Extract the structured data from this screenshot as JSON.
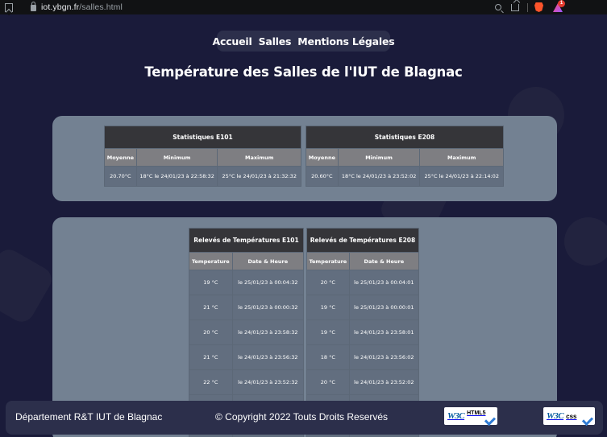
{
  "browser": {
    "url_domain": "iot.ybgn.fr",
    "url_path": "/salles.html",
    "rewards_count": "1"
  },
  "nav": {
    "items": [
      "Accueil",
      "Salles",
      "Mentions Légales"
    ]
  },
  "page_title": "Température des Salles de l'IUT de Blagnac",
  "stats": [
    {
      "title": "Statistiques E101",
      "headers": [
        "Moyenne",
        "Minimum",
        "Maximum"
      ],
      "row": [
        "20.70°C",
        "18°C le 24/01/23 à 22:58:32",
        "25°C le 24/01/23 à 21:32:32"
      ]
    },
    {
      "title": "Statistiques E208",
      "headers": [
        "Moyenne",
        "Minimum",
        "Maximum"
      ],
      "row": [
        "20.60°C",
        "18°C le 24/01/23 à 23:52:02",
        "25°C le 24/01/23 à 22:14:02"
      ]
    }
  ],
  "readings": [
    {
      "title": "Relevés de Températures E101",
      "headers": [
        "Temperature",
        "Date & Heure"
      ],
      "rows": [
        [
          "19 °C",
          "le 25/01/23 à 00:04:32"
        ],
        [
          "21 °C",
          "le 25/01/23 à 00:00:32"
        ],
        [
          "20 °C",
          "le 24/01/23 à 23:58:32"
        ],
        [
          "21 °C",
          "le 24/01/23 à 23:56:32"
        ],
        [
          "22 °C",
          "le 24/01/23 à 23:52:32"
        ],
        [
          "",
          ""
        ],
        [
          "",
          ""
        ]
      ]
    },
    {
      "title": "Relevés de Températures E208",
      "headers": [
        "Temperature",
        "Date & Heure"
      ],
      "rows": [
        [
          "20 °C",
          "le 25/01/23 à 00:04:01"
        ],
        [
          "19 °C",
          "le 25/01/23 à 00:00:01"
        ],
        [
          "19 °C",
          "le 24/01/23 à 23:58:01"
        ],
        [
          "18 °C",
          "le 24/01/23 à 23:56:02"
        ],
        [
          "20 °C",
          "le 24/01/23 à 23:52:02"
        ],
        [
          "",
          ""
        ],
        [
          "",
          ""
        ]
      ]
    }
  ],
  "footer": {
    "department": "Département R&T IUT de Blagnac",
    "copyright": "© Copyright 2022 Touts Droits Reservés",
    "badge_html": {
      "logo": "W3C",
      "tag": "HTML5"
    },
    "badge_css": {
      "logo": "W3C",
      "tag": "css"
    }
  },
  "colors": {
    "background": "#1a1b3a",
    "nav_bg": "#2c2f4b",
    "panel_bg": "#738192",
    "table_title_bg": "#353539",
    "table_header_bg": "#7e7e82",
    "table_cell_bg": "#626e7f"
  }
}
